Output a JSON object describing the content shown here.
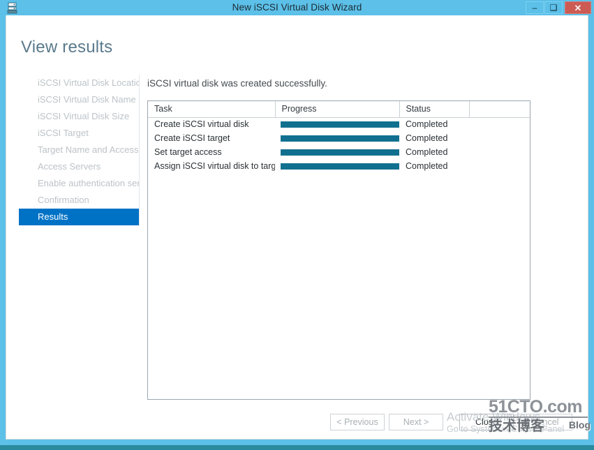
{
  "window": {
    "title": "New iSCSI Virtual Disk Wizard",
    "icon": "iscsi-disk-icon",
    "controls": {
      "minimize": "–",
      "maximize": "❑",
      "close": "✕"
    },
    "chrome_color": "#5cc0e8",
    "close_color": "#cc5b54"
  },
  "page": {
    "title": "View results",
    "title_color": "#5a7a8c",
    "result_message": "iSCSI virtual disk was created successfully."
  },
  "sidebar": {
    "items": [
      {
        "label": "iSCSI Virtual Disk Location",
        "active": false
      },
      {
        "label": "iSCSI Virtual Disk Name",
        "active": false
      },
      {
        "label": "iSCSI Virtual Disk Size",
        "active": false
      },
      {
        "label": "iSCSI Target",
        "active": false
      },
      {
        "label": "Target Name and Access",
        "active": false
      },
      {
        "label": "Access Servers",
        "active": false
      },
      {
        "label": "Enable authentication ser...",
        "active": false
      },
      {
        "label": "Confirmation",
        "active": false
      },
      {
        "label": "Results",
        "active": true
      }
    ],
    "active_color": "#0072c6",
    "inactive_color": "#bcc3c8"
  },
  "task_table": {
    "columns": [
      "Task",
      "Progress",
      "Status",
      ""
    ],
    "progress_color": "#11708f",
    "rows": [
      {
        "task": "Create iSCSI virtual disk",
        "progress": 100,
        "status": "Completed"
      },
      {
        "task": "Create iSCSI target",
        "progress": 100,
        "status": "Completed"
      },
      {
        "task": "Set target access",
        "progress": 100,
        "status": "Completed"
      },
      {
        "task": "Assign iSCSI virtual disk to target",
        "progress": 100,
        "status": "Completed"
      }
    ]
  },
  "footer": {
    "previous_label": "< Previous",
    "next_label": "Next >",
    "close_label": "Close",
    "cancel_label": "Cancel"
  },
  "watermarks": {
    "activation_line1": "Activate Windows",
    "activation_line2": "Go to System in Control Panel",
    "site_domain": "51CTO.com",
    "site_sub": "技术博客",
    "site_blog": "Blog"
  }
}
